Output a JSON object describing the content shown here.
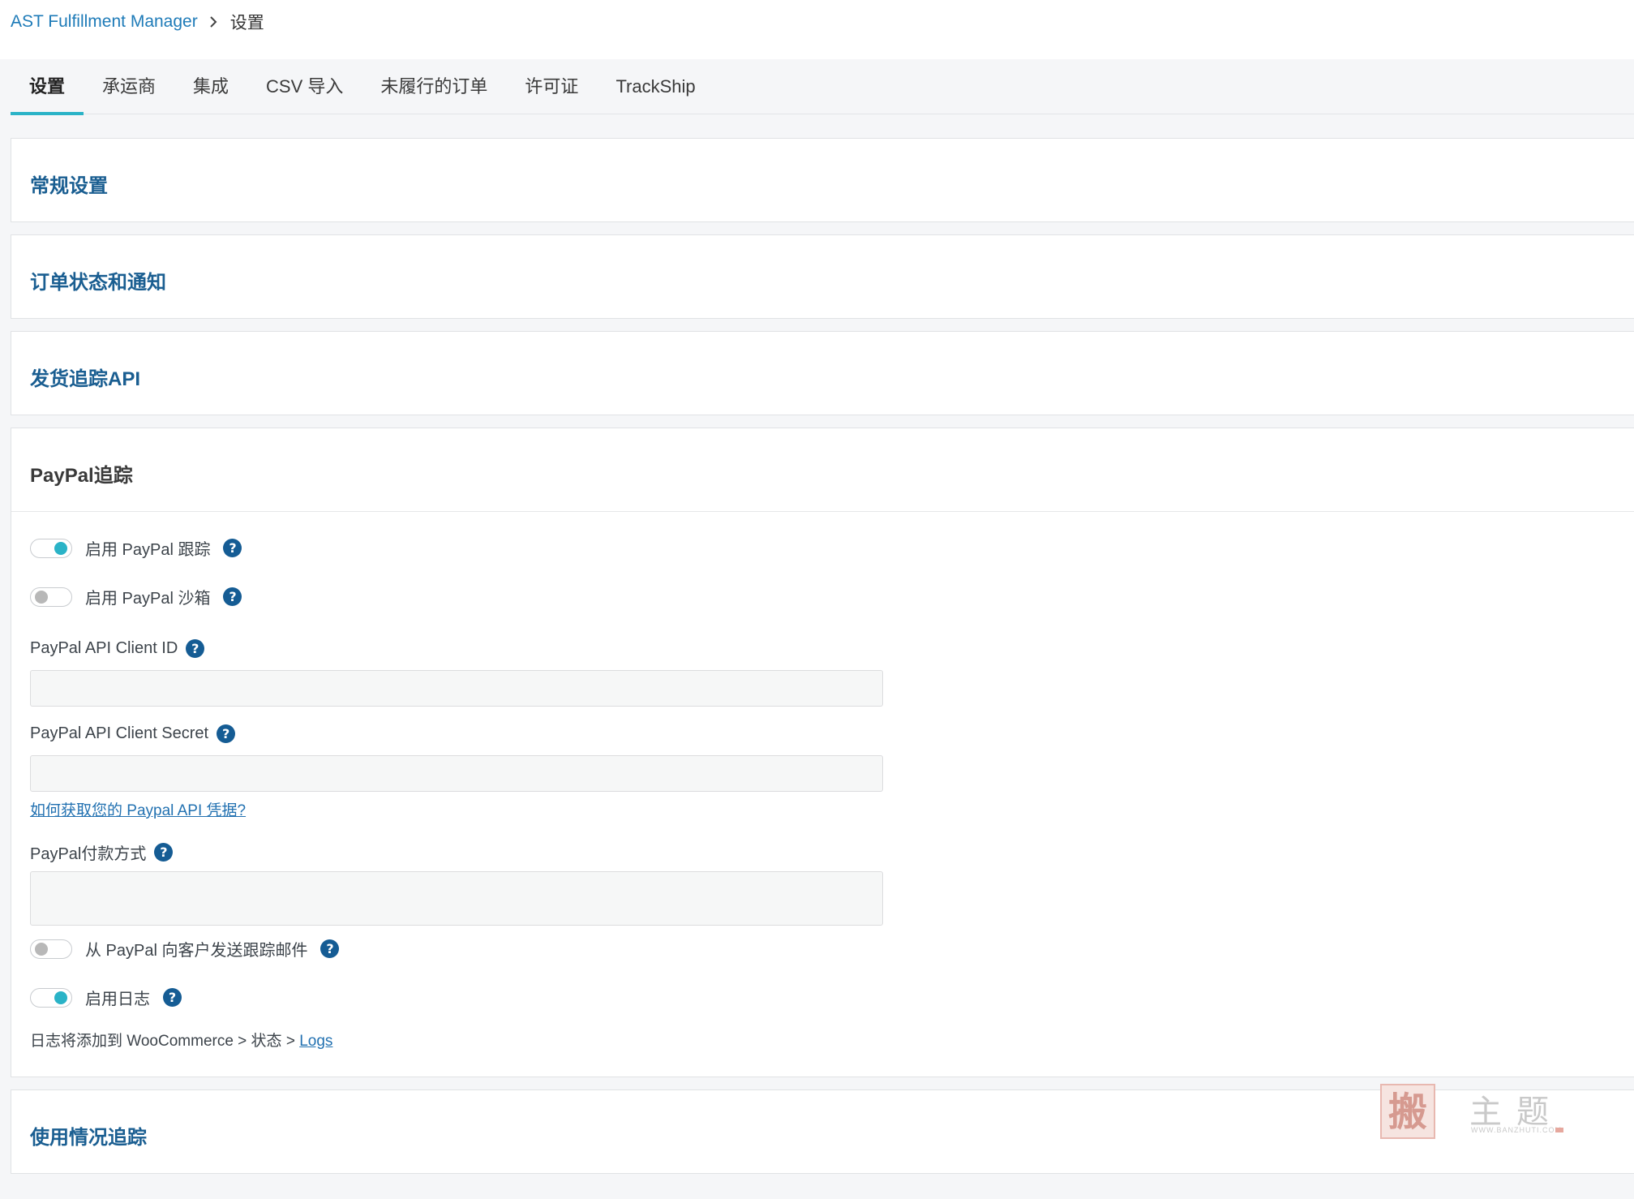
{
  "breadcrumb": {
    "app": "AST Fulfillment Manager",
    "current": "设置"
  },
  "tabs": [
    {
      "label": "设置",
      "active": true
    },
    {
      "label": "承运商"
    },
    {
      "label": "集成"
    },
    {
      "label": "CSV 导入"
    },
    {
      "label": "未履行的订单"
    },
    {
      "label": "许可证"
    },
    {
      "label": "TrackShip"
    }
  ],
  "sections": {
    "general": "常规设置",
    "order_status": "订单状态和通知",
    "shipment_api": "发货追踪API",
    "paypal": "PayPal追踪",
    "usage": "使用情况追踪"
  },
  "paypal": {
    "enable_tracking": {
      "label": "启用 PayPal 跟踪",
      "on": true
    },
    "enable_sandbox": {
      "label": "启用 PayPal 沙箱",
      "on": false
    },
    "client_id": {
      "label": "PayPal API Client ID",
      "value": ""
    },
    "client_secret": {
      "label": "PayPal API Client Secret",
      "value": ""
    },
    "credentials_link": "如何获取您的 Paypal API 凭据?",
    "payment_methods": {
      "label": "PayPal付款方式",
      "value": ""
    },
    "send_email": {
      "label": "从 PayPal 向客户发送跟踪邮件",
      "on": false
    },
    "enable_log": {
      "label": "启用日志",
      "on": true
    },
    "log_note": "日志将添加到 WooCommerce > 状态 > ",
    "log_link": "Logs"
  },
  "icons": {
    "help": "?"
  },
  "colors": {
    "accent": "#2ab3c7",
    "title": "#1a5e91",
    "help": "#155c94",
    "link": "#2271b1"
  }
}
